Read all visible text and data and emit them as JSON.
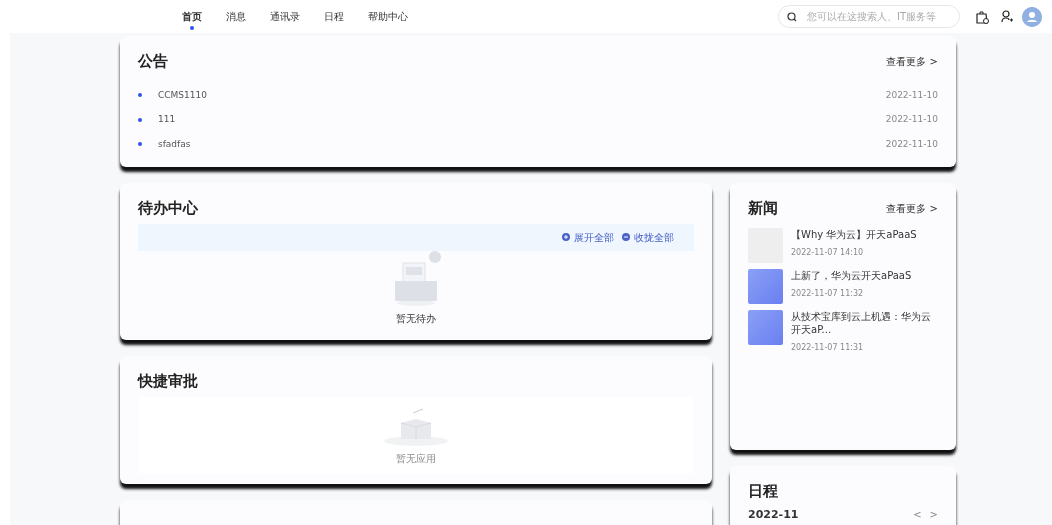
{
  "nav": {
    "tabs": [
      {
        "label": "首页",
        "selected": true
      },
      {
        "label": "消息",
        "selected": false
      },
      {
        "label": "通讯录",
        "selected": false
      },
      {
        "label": "日程",
        "selected": false
      },
      {
        "label": "帮助中心",
        "selected": false
      }
    ],
    "search": {
      "placeholder": "您可以在这搜索人、IT服务等"
    }
  },
  "announcements": {
    "title": "公告",
    "more": "查看更多 >",
    "items": [
      {
        "text": "CCMS1110",
        "date": "2022-11-10"
      },
      {
        "text": "111",
        "date": "2022-11-10"
      },
      {
        "text": "sfadfas",
        "date": "2022-11-10"
      }
    ]
  },
  "todo": {
    "title": "待办中心",
    "expand_all": "展开全部",
    "collapse_all": "收拢全部",
    "empty": "暂无待办"
  },
  "quick_approval": {
    "title": "快捷审批",
    "empty": "暂无应用"
  },
  "news": {
    "title": "新闻",
    "more": "查看更多 >",
    "items": [
      {
        "kind": "video",
        "title": "【Why 华为云】开天aPaaS",
        "time": "2022-11-07 14:10"
      },
      {
        "kind": "new",
        "title": "上新了，华为云开天aPaaS",
        "time": "2022-11-07 11:32"
      },
      {
        "kind": "new",
        "title": "从技术宝库到云上机遇：华为云开天aP...",
        "time": "2022-11-07 11:31"
      }
    ]
  },
  "schedule": {
    "title": "日程",
    "month": "2022-11",
    "prev": "<",
    "next": ">"
  }
}
